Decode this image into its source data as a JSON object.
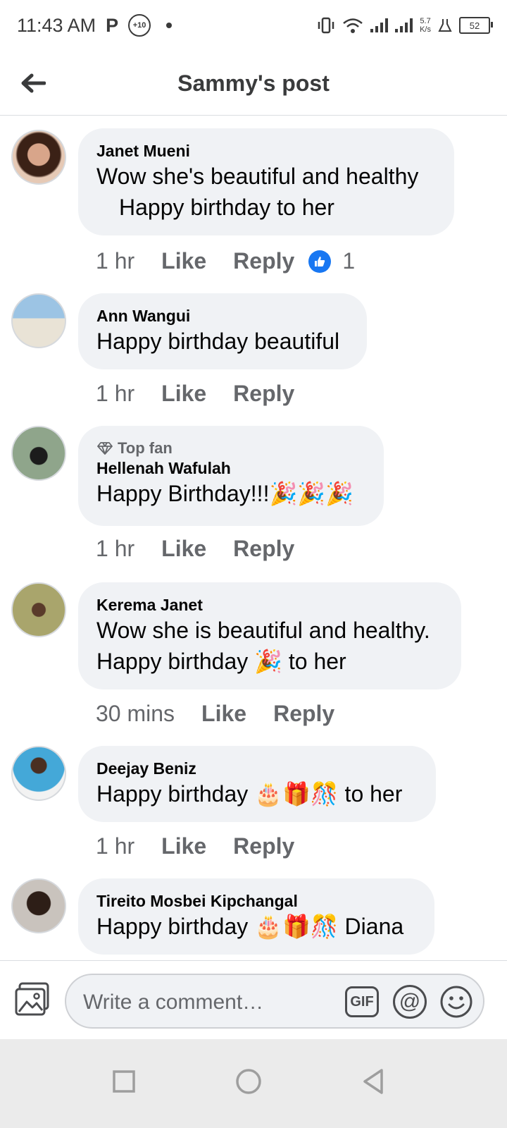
{
  "status_bar": {
    "time": "11:43 AM",
    "app_icon": "P",
    "badge": "+10",
    "net_speed_value": "5.7",
    "net_speed_unit": "K/s",
    "battery": "52"
  },
  "header": {
    "title": "Sammy's post",
    "back_icon": "arrow-left-icon"
  },
  "comments": [
    {
      "author": "Janet Mueni",
      "text_line1": "Wow she's beautiful and healthy",
      "text_line2": "Happy birthday to her",
      "time": "1 hr",
      "like": "Like",
      "reply": "Reply",
      "reaction_count": "1"
    },
    {
      "author": "Ann Wangui",
      "text": "Happy birthday beautiful",
      "time": "1 hr",
      "like": "Like",
      "reply": "Reply"
    },
    {
      "badge": "Top fan",
      "author": "Hellenah Wafulah",
      "text": "Happy Birthday!!!🎉🎉🎉",
      "time": "1 hr",
      "like": "Like",
      "reply": "Reply"
    },
    {
      "author": "Kerema Janet",
      "text_line1": "Wow she is beautiful and healthy.",
      "text_line2": "Happy birthday 🎉 to her",
      "time": "30 mins",
      "like": "Like",
      "reply": "Reply"
    },
    {
      "author": "Deejay Beniz",
      "text": "Happy birthday 🎂🎁🎊 to her",
      "time": "1 hr",
      "like": "Like",
      "reply": "Reply"
    },
    {
      "author": "Tireito Mosbei Kipchangal",
      "text": "Happy birthday 🎂🎁🎊 Diana"
    }
  ],
  "composer": {
    "placeholder": "Write a comment…",
    "gif_label": "GIF",
    "mention_label": "@"
  },
  "colors": {
    "bubble": "#f0f2f5",
    "meta": "#65676b",
    "like_blue": "#1877f2",
    "navbar": "#ebebeb"
  }
}
